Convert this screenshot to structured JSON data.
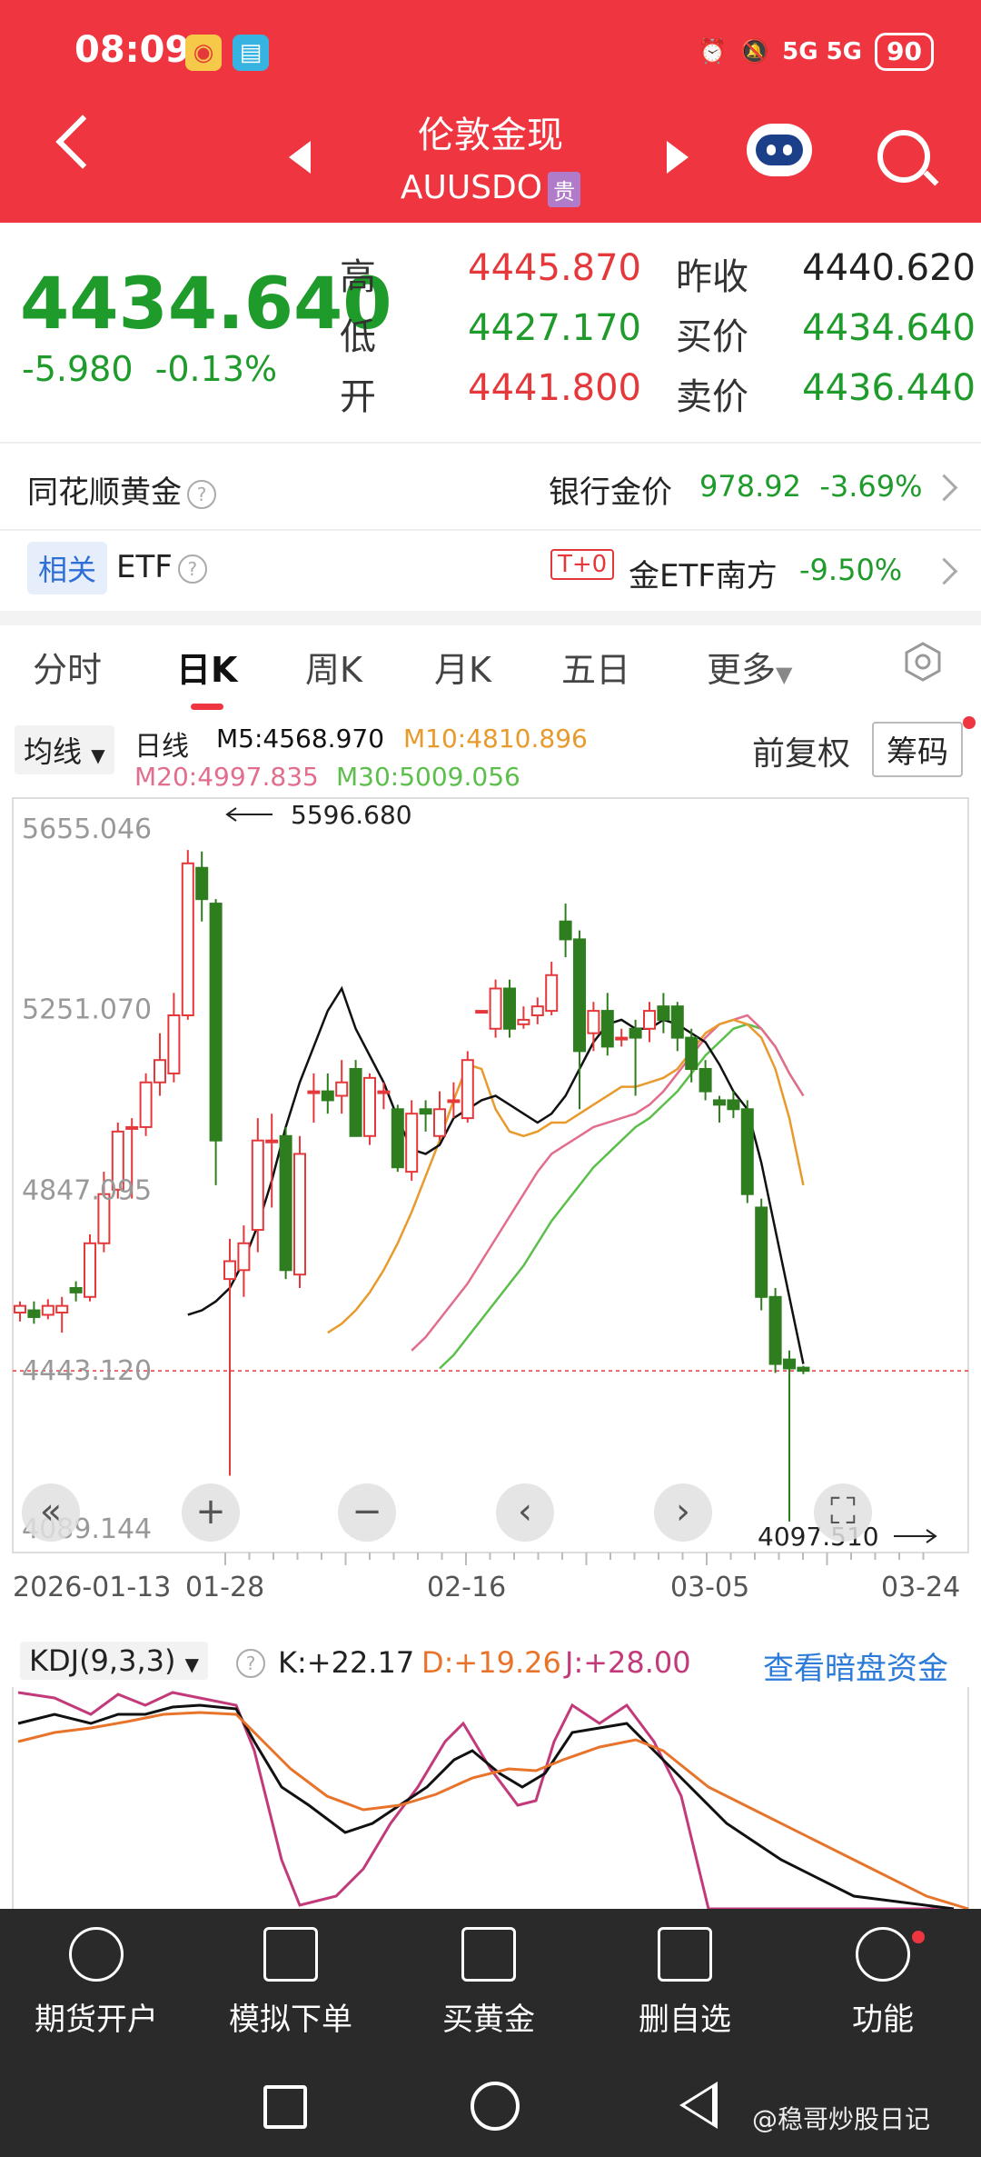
{
  "status_bar": {
    "time": "08:09",
    "signal": "5G 5G",
    "battery": "90"
  },
  "header": {
    "title": "伦敦金现",
    "symbol": "AUUSDO",
    "badge": "贵"
  },
  "quote": {
    "price": "4434.640",
    "change": "-5.980",
    "change_pct": "-0.13%",
    "high_label": "高",
    "high": "4445.870",
    "low_label": "低",
    "low": "4427.170",
    "open_label": "开",
    "open": "4441.800",
    "prev_close_label": "昨收",
    "prev_close": "4440.620",
    "bid_label": "买价",
    "bid": "4434.640",
    "ask_label": "卖价",
    "ask": "4436.440"
  },
  "gold_row": {
    "label": "同花顺黄金",
    "bank_label": "银行金价",
    "bank_price": "978.92",
    "bank_change": "-3.69%"
  },
  "etf_row": {
    "tag": "相关",
    "label": "ETF",
    "t0": "T+0",
    "name": "金ETF南方",
    "change": "-9.50%"
  },
  "tabs": [
    "分时",
    "日K",
    "周K",
    "月K",
    "五日",
    "更多"
  ],
  "ma_bar": {
    "select": "均线",
    "day": "日线",
    "m5": "M5:4568.970",
    "m10": "M10:4810.896",
    "m20": "M20:4997.835",
    "m30": "M30:5009.056",
    "fq": "前复权",
    "chip": "筹码"
  },
  "colors": {
    "up": "#e5383b",
    "down": "#2e7d1f",
    "m5": "#111111",
    "m10": "#e89a2c",
    "m20": "#e26d8c",
    "m30": "#5cbf4c"
  },
  "chart_data": {
    "type": "candlestick",
    "ylim": [
      4089.144,
      5655.046
    ],
    "y_ticks": [
      "5655.046",
      "5251.070",
      "4847.095",
      "4443.120",
      "4089.144"
    ],
    "x_ticks": [
      "2026-01-13",
      "01-28",
      "02-16",
      "03-05",
      "03-24"
    ],
    "max_label": "5596.680",
    "min_label": "4097.510",
    "current_price": 4434.64,
    "candles": [
      [
        4565,
        4580,
        4545,
        4590
      ],
      [
        4570,
        4555,
        4540,
        4590
      ],
      [
        4560,
        4580,
        4550,
        4595
      ],
      [
        4565,
        4580,
        4520,
        4600
      ],
      [
        4620,
        4610,
        4590,
        4635
      ],
      [
        4600,
        4720,
        4590,
        4740
      ],
      [
        4720,
        4830,
        4700,
        4880
      ],
      [
        4840,
        4970,
        4820,
        4990
      ],
      [
        4980,
        4980,
        4820,
        5000
      ],
      [
        4980,
        5080,
        4960,
        5100
      ],
      [
        5080,
        5130,
        5050,
        5190
      ],
      [
        5100,
        5230,
        5080,
        5280
      ],
      [
        5230,
        5570,
        5220,
        5600
      ],
      [
        5560,
        5490,
        5440,
        5596.68
      ],
      [
        5480,
        4950,
        4850,
        5490
      ],
      [
        4640,
        4680,
        4200,
        4730
      ],
      [
        4660,
        4720,
        4600,
        4760
      ],
      [
        4750,
        4950,
        4700,
        5000
      ],
      [
        4950,
        4950,
        4800,
        5010
      ],
      [
        4960,
        4660,
        4640,
        4980
      ],
      [
        4650,
        4920,
        4620,
        4960
      ],
      [
        5060,
        5060,
        4990,
        5100
      ],
      [
        5060,
        5040,
        5010,
        5100
      ],
      [
        5050,
        5080,
        5010,
        5130
      ],
      [
        5110,
        4960,
        4960,
        5130
      ],
      [
        4960,
        5090,
        4940,
        5100
      ],
      [
        5060,
        5060,
        5020,
        5080
      ],
      [
        5020,
        4890,
        4880,
        5030
      ],
      [
        4880,
        5010,
        4860,
        5040
      ],
      [
        5020,
        5010,
        4970,
        5040
      ],
      [
        4960,
        5020,
        4950,
        5060
      ],
      [
        5040,
        5040,
        5000,
        5080
      ],
      [
        5000,
        5130,
        4990,
        5150
      ],
      [
        5240,
        5240,
        5240,
        5240
      ],
      [
        5200,
        5290,
        5180,
        5310
      ],
      [
        5290,
        5200,
        5180,
        5310
      ],
      [
        5210,
        5220,
        5200,
        5250
      ],
      [
        5230,
        5250,
        5210,
        5270
      ],
      [
        5240,
        5320,
        5230,
        5350
      ],
      [
        5440,
        5400,
        5360,
        5480
      ],
      [
        5400,
        5150,
        5020,
        5420
      ],
      [
        5190,
        5240,
        5150,
        5260
      ],
      [
        5240,
        5160,
        5140,
        5280
      ],
      [
        5180,
        5180,
        5160,
        5200
      ],
      [
        5200,
        5180,
        5050,
        5220
      ],
      [
        5200,
        5240,
        5170,
        5260
      ],
      [
        5250,
        5220,
        5190,
        5280
      ],
      [
        5250,
        5180,
        5150,
        5260
      ],
      [
        5180,
        5110,
        5080,
        5200
      ],
      [
        5110,
        5060,
        5040,
        5130
      ],
      [
        5040,
        5030,
        4990,
        5050
      ],
      [
        5040,
        5020,
        5000,
        5060
      ],
      [
        5020,
        4830,
        4810,
        5040
      ],
      [
        4800,
        4600,
        4570,
        4820
      ],
      [
        4600,
        4450,
        4430,
        4620
      ],
      [
        4460,
        4440,
        4097.51,
        4480
      ],
      [
        4441.8,
        4434.64,
        4427.17,
        4445.87
      ]
    ],
    "ma5": [
      4560,
      4570,
      4590,
      4620,
      4680,
      4760,
      4860,
      4980,
      5080,
      5160,
      5240,
      5290,
      5200,
      5140,
      5080,
      5000,
      4930,
      4920,
      4940,
      5000,
      5020,
      5040,
      5050,
      5030,
      5010,
      4990,
      5010,
      5050,
      5110,
      5170,
      5210,
      5220,
      5200,
      5200,
      5220,
      5210,
      5190,
      5170,
      5120,
      5060,
      5020,
      4900,
      4750,
      4600,
      4450
    ],
    "ma10": [
      4520,
      4540,
      4570,
      4610,
      4660,
      4720,
      4790,
      4870,
      4950,
      5040,
      5120,
      5110,
      5020,
      4970,
      4960,
      4970,
      4990,
      4990,
      5010,
      5030,
      5050,
      5070,
      5070,
      5080,
      5090,
      5110,
      5150,
      5190,
      5210,
      5220,
      5210,
      5180,
      5110,
      5000,
      4850
    ],
    "ma20": [
      4480,
      4510,
      4550,
      4590,
      4630,
      4680,
      4730,
      4780,
      4830,
      4880,
      4920,
      4940,
      4960,
      4980,
      4990,
      5000,
      5010,
      5030,
      5060,
      5100,
      5140,
      5180,
      5210,
      5220,
      5230,
      5200,
      5160,
      5100,
      5050
    ],
    "ma30": [
      4440,
      4470,
      4510,
      4550,
      4590,
      4630,
      4670,
      4720,
      4770,
      4810,
      4850,
      4890,
      4920,
      4950,
      4980,
      5000,
      5030,
      5060,
      5100,
      5140,
      5170,
      5200,
      5210,
      5200,
      5160,
      5100,
      5050
    ]
  },
  "kdj": {
    "select": "KDJ(9,3,3)",
    "k": "K:+22.17",
    "d": "D:+19.26",
    "j": "J:+28.00",
    "link": "查看暗盘资金"
  },
  "bottom_nav": [
    "期货开户",
    "模拟下单",
    "买黄金",
    "删自选",
    "功能"
  ],
  "watermark": "@稳哥炒股日记"
}
